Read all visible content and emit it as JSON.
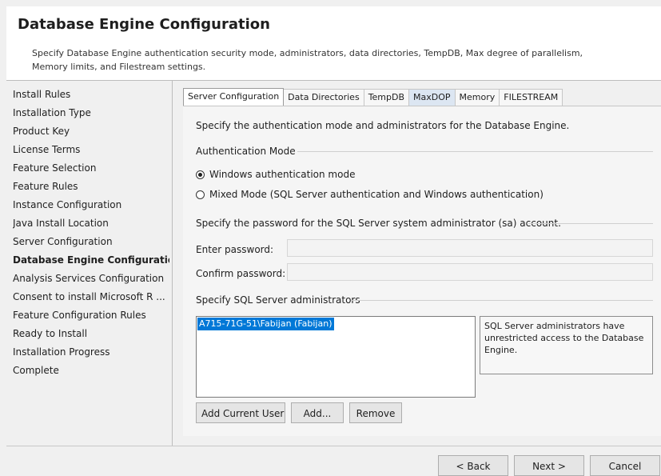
{
  "header": {
    "title": "Database Engine Configuration",
    "description": "Specify Database Engine authentication security mode, administrators, data directories, TempDB, Max degree of parallelism, Memory limits, and Filestream settings."
  },
  "steps": [
    {
      "label": "Install Rules",
      "active": false
    },
    {
      "label": "Installation Type",
      "active": false
    },
    {
      "label": "Product Key",
      "active": false
    },
    {
      "label": "License Terms",
      "active": false
    },
    {
      "label": "Feature Selection",
      "active": false
    },
    {
      "label": "Feature Rules",
      "active": false
    },
    {
      "label": "Instance Configuration",
      "active": false
    },
    {
      "label": "Java Install Location",
      "active": false
    },
    {
      "label": "Server Configuration",
      "active": false
    },
    {
      "label": "Database Engine Configuration",
      "active": true
    },
    {
      "label": "Analysis Services Configuration",
      "active": false
    },
    {
      "label": "Consent to install Microsoft R ...",
      "active": false
    },
    {
      "label": "Feature Configuration Rules",
      "active": false
    },
    {
      "label": "Ready to Install",
      "active": false
    },
    {
      "label": "Installation Progress",
      "active": false
    },
    {
      "label": "Complete",
      "active": false
    }
  ],
  "tabs": [
    {
      "label": "Server Configuration",
      "active": true
    },
    {
      "label": "Data Directories",
      "active": false
    },
    {
      "label": "TempDB",
      "active": false
    },
    {
      "label": "MaxDOP",
      "active": false,
      "hover": true
    },
    {
      "label": "Memory",
      "active": false
    },
    {
      "label": "FILESTREAM",
      "active": false
    }
  ],
  "server_config": {
    "intro": "Specify the authentication mode and administrators for the Database Engine.",
    "auth_group_label": "Authentication Mode",
    "windows_auth_label": "Windows authentication mode",
    "mixed_mode_label": "Mixed Mode (SQL Server authentication and Windows authentication)",
    "selected_mode": "windows",
    "sa_group_label": "Specify the password for the SQL Server system administrator (sa) account.",
    "enter_password_label": "Enter password:",
    "enter_password_value": "",
    "confirm_password_label": "Confirm password:",
    "confirm_password_value": "",
    "admins_group_label": "Specify SQL Server administrators",
    "admins": [
      "A715-71G-51\\Fabijan (Fabijan)"
    ],
    "admins_info": "SQL Server administrators have unrestricted access to the Database Engine.",
    "add_current_user_label": "Add Current User",
    "add_label": "Add...",
    "remove_label": "Remove"
  },
  "footer": {
    "back_label": "< Back",
    "next_label": "Next >",
    "cancel_label": "Cancel"
  },
  "colors": {
    "selection": "#0078d7",
    "tab_hover": "#dce6f2"
  }
}
